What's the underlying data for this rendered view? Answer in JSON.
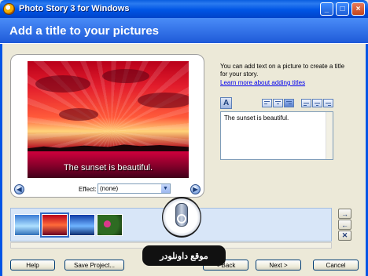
{
  "window": {
    "title": "Photo Story 3 for Windows",
    "controls": {
      "minimize": "_",
      "maximize": "□",
      "close": "×"
    }
  },
  "header": {
    "title": "Add a title to your pictures"
  },
  "preview": {
    "caption": "The sunset is beautiful.",
    "effect_label": "Effect:",
    "effect_value": "(none)",
    "prev_icon": "arrow-left-icon",
    "next_icon": "arrow-right-icon"
  },
  "info": {
    "text": "You can add text on a picture to create a title for your story.",
    "link": "Learn more about adding titles"
  },
  "title_editor": {
    "text": "The sunset is beautiful.",
    "toolbar": [
      "font-icon",
      "align-top-left-icon",
      "align-top-center-icon",
      "align-top-right-icon",
      "align-middle-left-icon",
      "align-middle-center-icon",
      "align-middle-right-icon"
    ]
  },
  "filmstrip": {
    "thumbnails": [
      "ocean-thumbnail",
      "sunset-thumbnail",
      "waves-thumbnail",
      "flowers-thumbnail"
    ],
    "selected_index": 1,
    "side_buttons": [
      "→",
      "←",
      "✕"
    ]
  },
  "buttons": {
    "help": "Help",
    "save_project": "Save Project...",
    "back": "< Back",
    "next": "Next >",
    "cancel": "Cancel"
  },
  "watermark": {
    "text": "موقع داونلودر"
  },
  "colors": {
    "header_blue": "#2a6fe8",
    "accent": "#316ac5"
  }
}
